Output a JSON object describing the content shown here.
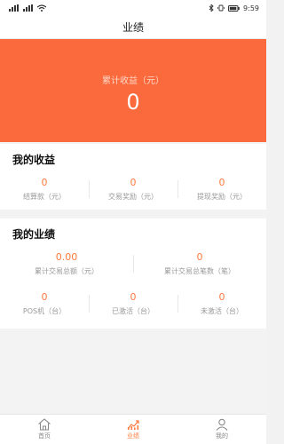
{
  "status_bar": {
    "time": "9:59"
  },
  "header": {
    "title": "业绩"
  },
  "banner": {
    "label": "累计收益（元）",
    "value": "0"
  },
  "earnings": {
    "title": "我的收益",
    "stats": [
      {
        "value": "0",
        "label": "结算款（元）"
      },
      {
        "value": "0",
        "label": "交易奖励（元）"
      },
      {
        "value": "0",
        "label": "提现奖励（元）"
      }
    ]
  },
  "performance": {
    "title": "我的业绩",
    "row1": [
      {
        "value": "0.00",
        "label": "累计交易总额（元）"
      },
      {
        "value": "0",
        "label": "累计交易总笔数（笔）"
      }
    ],
    "row2": [
      {
        "value": "0",
        "label": "POS机（台）"
      },
      {
        "value": "0",
        "label": "已激活（台）"
      },
      {
        "value": "0",
        "label": "未激活（台）"
      }
    ]
  },
  "bottom_nav": {
    "items": [
      {
        "label": "首页",
        "icon": "home-icon",
        "active": false
      },
      {
        "label": "业绩",
        "icon": "chart-icon",
        "active": true
      },
      {
        "label": "我的",
        "icon": "user-icon",
        "active": false
      }
    ]
  },
  "colors": {
    "accent": "#fb6a3c",
    "value_orange": "#ff7a3e",
    "label_gray": "#999999"
  }
}
